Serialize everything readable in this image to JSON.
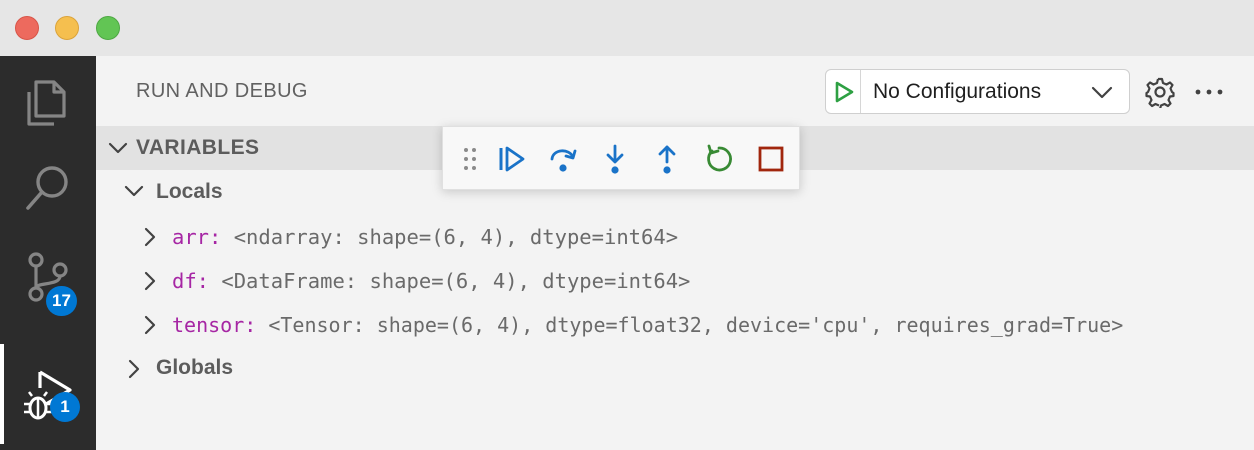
{
  "window": {
    "controls": [
      "close",
      "minimize",
      "zoom"
    ]
  },
  "activity_bar": {
    "items": [
      {
        "icon": "files-icon",
        "badge": ""
      },
      {
        "icon": "search-icon",
        "badge": ""
      },
      {
        "icon": "source-control-icon",
        "badge": "17"
      },
      {
        "icon": "run-and-debug-icon",
        "badge": "1",
        "active": true
      }
    ]
  },
  "sidebar": {
    "title": "RUN AND DEBUG",
    "config": {
      "label": "No Configurations",
      "play_color": "#2ea043"
    },
    "variables": {
      "header": "VARIABLES",
      "locals": {
        "label": "Locals",
        "items": [
          {
            "name": "arr:",
            "value": "<ndarray: shape=(6, 4), dtype=int64>"
          },
          {
            "name": "df:",
            "value": "<DataFrame: shape=(6, 4), dtype=int64>"
          },
          {
            "name": "tensor:",
            "value": "<Tensor: shape=(6, 4), dtype=float32, device='cpu', requires_grad=True>"
          }
        ]
      },
      "globals": {
        "label": "Globals"
      }
    }
  },
  "debug_toolbar": {
    "buttons": [
      "continue",
      "step-over",
      "step-into",
      "step-out",
      "restart",
      "stop"
    ],
    "colors": {
      "blue": "#1a73c8",
      "green": "#388a34",
      "red": "#a1260d"
    }
  }
}
